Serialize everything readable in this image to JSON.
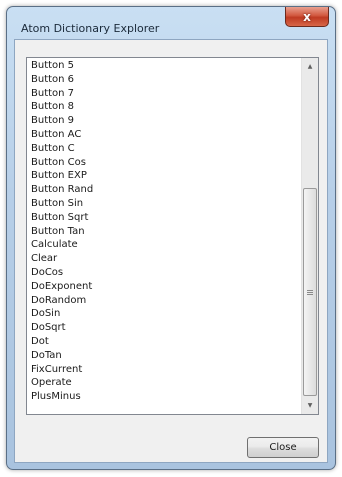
{
  "window": {
    "title": "Atom Dictionary Explorer",
    "close_glyph": "x"
  },
  "list": {
    "items": [
      "Button 5",
      "Button 6",
      "Button 7",
      "Button 8",
      "Button 9",
      "Button AC",
      "Button C",
      "Button Cos",
      "Button EXP",
      "Button Rand",
      "Button Sin",
      "Button Sqrt",
      "Button Tan",
      "Calculate",
      "Clear",
      "DoCos",
      "DoExponent",
      "DoRandom",
      "DoSin",
      "DoSqrt",
      "Dot",
      "DoTan",
      "FixCurrent",
      "Operate",
      "PlusMinus"
    ]
  },
  "scrollbar": {
    "up_arrow": "▲",
    "down_arrow": "▼"
  },
  "buttons": {
    "close_label": "Close"
  }
}
